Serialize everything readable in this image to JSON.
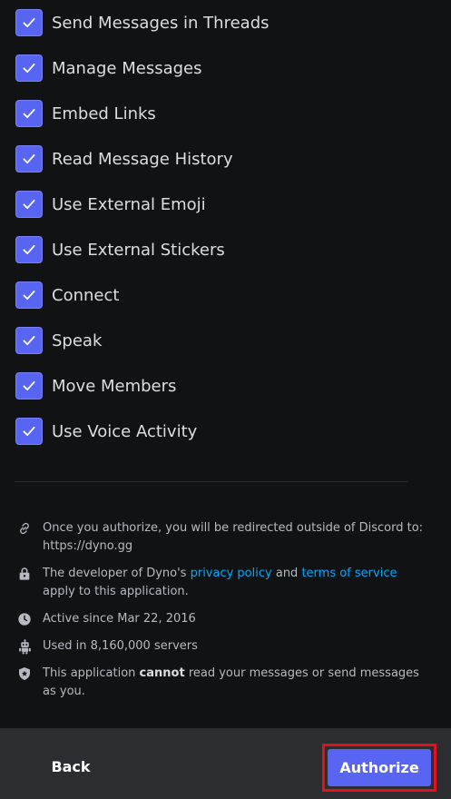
{
  "permissions": [
    {
      "label": "Send Messages in Threads",
      "checked": true
    },
    {
      "label": "Manage Messages",
      "checked": true
    },
    {
      "label": "Embed Links",
      "checked": true
    },
    {
      "label": "Read Message History",
      "checked": true
    },
    {
      "label": "Use External Emoji",
      "checked": true
    },
    {
      "label": "Use External Stickers",
      "checked": true
    },
    {
      "label": "Connect",
      "checked": true
    },
    {
      "label": "Speak",
      "checked": true
    },
    {
      "label": "Move Members",
      "checked": true
    },
    {
      "label": "Use Voice Activity",
      "checked": true
    }
  ],
  "info": {
    "redirect": {
      "icon": "link-icon",
      "text": "Once you authorize, you will be redirected outside of Discord to: https://dyno.gg"
    },
    "developer": {
      "icon": "lock-icon",
      "prefix": "The developer of Dyno's ",
      "privacy_link": "privacy policy",
      "middle": " and ",
      "terms_link": "terms of service",
      "suffix": " apply to this application."
    },
    "active": {
      "icon": "clock-icon",
      "text": "Active since Mar 22, 2016"
    },
    "servers": {
      "icon": "robot-icon",
      "text": "Used in 8,160,000 servers"
    },
    "privacy": {
      "icon": "shield-icon",
      "prefix": "This application ",
      "emphasis": "cannot",
      "suffix": " read your messages or send messages as you."
    }
  },
  "footer": {
    "back_label": "Back",
    "authorize_label": "Authorize"
  },
  "colors": {
    "background": "#111214",
    "footer": "#2b2d31",
    "accent": "#5865f2",
    "link": "#00a8fc",
    "highlight_outline": "#e4101b"
  }
}
